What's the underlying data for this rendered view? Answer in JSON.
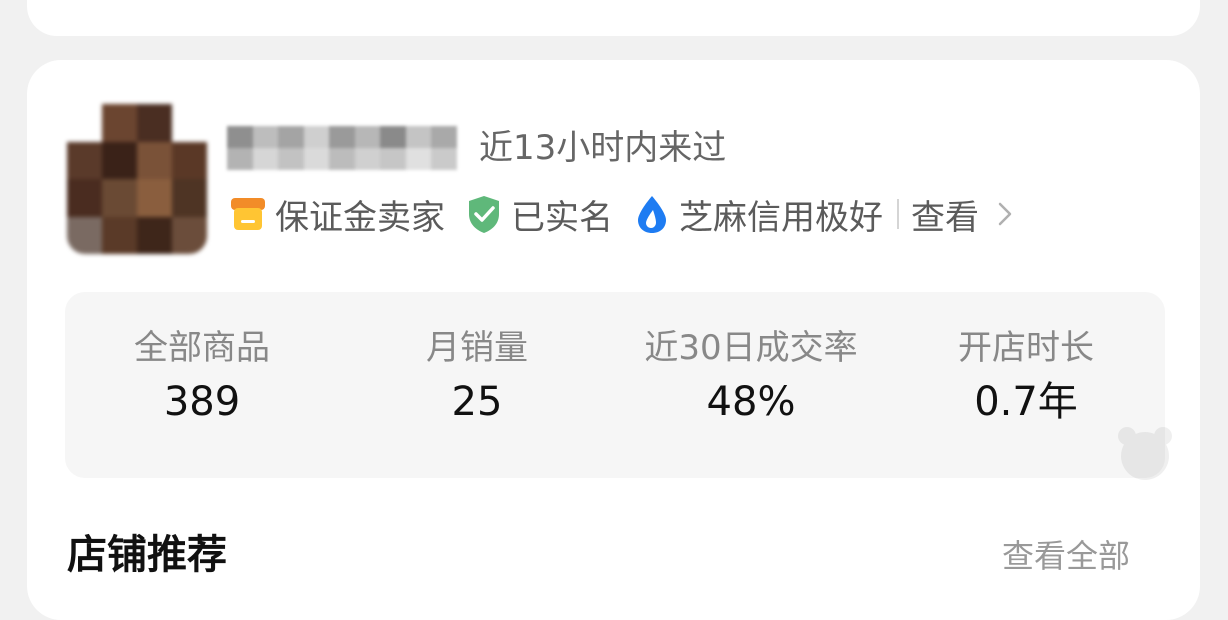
{
  "seller": {
    "last_seen": "近13小时内来过"
  },
  "badges": [
    {
      "label": "保证金卖家",
      "icon": "store-icon",
      "color": "#f5a623"
    },
    {
      "label": "已实名",
      "icon": "shield-check-icon",
      "color": "#5fb87a"
    },
    {
      "label": "芝麻信用极好",
      "icon": "water-drop-icon",
      "color": "#1e7cf2"
    }
  ],
  "view_label": "查看",
  "stats": [
    {
      "label": "全部商品",
      "value": "389"
    },
    {
      "label": "月销量",
      "value": "25"
    },
    {
      "label": "近30日成交率",
      "value": "48%"
    },
    {
      "label": "开店时长",
      "value": "0.7年"
    }
  ],
  "section": {
    "title": "店铺推荐",
    "view_all": "查看全部"
  },
  "colors": {
    "page_bg": "#f1f1f1",
    "card_bg": "#ffffff",
    "panel_bg": "#f6f6f6"
  }
}
